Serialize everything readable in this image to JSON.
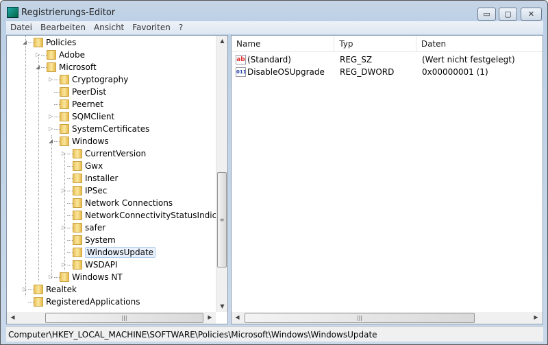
{
  "window": {
    "title": "Registrierungs-Editor",
    "minimize": "▭",
    "maximize": "▢",
    "close": "✕"
  },
  "menu": [
    "Datei",
    "Bearbeiten",
    "Ansicht",
    "Favoriten",
    "?"
  ],
  "tree": [
    {
      "label": "Policies",
      "level": 0,
      "expander": "expanded"
    },
    {
      "label": "Adobe",
      "level": 1,
      "expander": "collapsed"
    },
    {
      "label": "Microsoft",
      "level": 1,
      "expander": "expanded"
    },
    {
      "label": "Cryptography",
      "level": 2,
      "expander": "collapsed"
    },
    {
      "label": "PeerDist",
      "level": 2,
      "expander": "none"
    },
    {
      "label": "Peernet",
      "level": 2,
      "expander": "none"
    },
    {
      "label": "SQMClient",
      "level": 2,
      "expander": "collapsed"
    },
    {
      "label": "SystemCertificates",
      "level": 2,
      "expander": "collapsed"
    },
    {
      "label": "Windows",
      "level": 2,
      "expander": "expanded"
    },
    {
      "label": "CurrentVersion",
      "level": 3,
      "expander": "collapsed"
    },
    {
      "label": "Gwx",
      "level": 3,
      "expander": "none"
    },
    {
      "label": "Installer",
      "level": 3,
      "expander": "none"
    },
    {
      "label": "IPSec",
      "level": 3,
      "expander": "collapsed"
    },
    {
      "label": "Network Connections",
      "level": 3,
      "expander": "none"
    },
    {
      "label": "NetworkConnectivityStatusIndicator",
      "level": 3,
      "expander": "none"
    },
    {
      "label": "safer",
      "level": 3,
      "expander": "collapsed"
    },
    {
      "label": "System",
      "level": 3,
      "expander": "none"
    },
    {
      "label": "WindowsUpdate",
      "level": 3,
      "expander": "none",
      "selected": true
    },
    {
      "label": "WSDAPI",
      "level": 3,
      "expander": "collapsed"
    },
    {
      "label": "Windows NT",
      "level": 2,
      "expander": "collapsed"
    },
    {
      "label": "Realtek",
      "level": 0,
      "expander": "collapsed"
    },
    {
      "label": "RegisteredApplications",
      "level": 0,
      "expander": "none"
    }
  ],
  "columns": {
    "name": "Name",
    "type": "Typ",
    "data": "Daten"
  },
  "values": [
    {
      "icon": "string-value-icon",
      "icon_text": "ab",
      "name": "(Standard)",
      "type": "REG_SZ",
      "data": "(Wert nicht festgelegt)"
    },
    {
      "icon": "binary-value-icon",
      "icon_text": "011",
      "name": "DisableOSUpgrade",
      "type": "REG_DWORD",
      "data": "0x00000001 (1)"
    }
  ],
  "status": "Computer\\HKEY_LOCAL_MACHINE\\SOFTWARE\\Policies\\Microsoft\\Windows\\WindowsUpdate"
}
